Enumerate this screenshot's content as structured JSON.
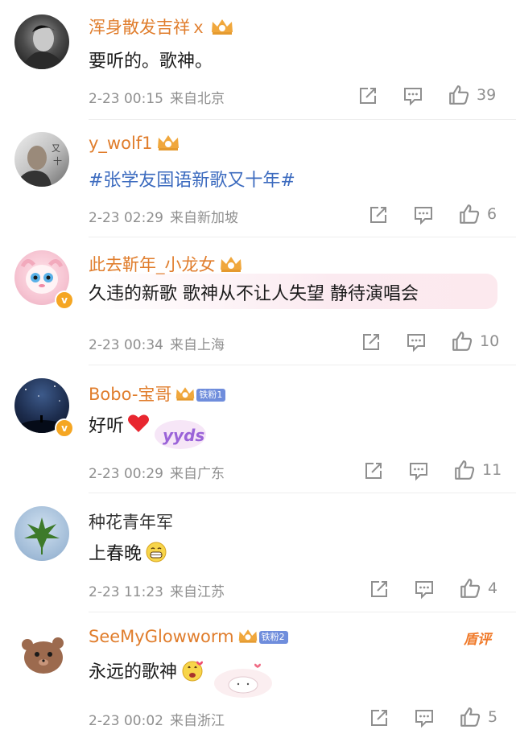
{
  "comments": [
    {
      "name": "浑身散发吉祥ｘ",
      "text": "要听的。歌神。",
      "date": "2-23 00:15",
      "location": "来自北京",
      "likes": "39"
    },
    {
      "name": "y_wolf1",
      "text": "#张学友国语新歌又十年#",
      "date": "2-23 02:29",
      "location": "来自新加坡",
      "likes": "6"
    },
    {
      "name": "此去靳年_小龙女",
      "text": "久违的新歌 歌神从不让人失望 静待演唱会",
      "date": "2-23 00:34",
      "location": "来自上海",
      "likes": "10"
    },
    {
      "name": "Bobo-宝哥",
      "fan_badge": "铁粉1",
      "text": "好听",
      "sticker": "yyds",
      "date": "2-23 00:29",
      "location": "来自广东",
      "likes": "11"
    },
    {
      "name": "种花青年军",
      "text": "上春晚",
      "date": "2-23 11:23",
      "location": "来自江苏",
      "likes": "4"
    },
    {
      "name": "SeeMyGlowworm",
      "fan_badge": "铁粉2",
      "hot_label": "盾评",
      "text": "永远的歌神",
      "date": "2-23 00:02",
      "location": "来自浙江",
      "likes": "5"
    }
  ],
  "icons": [
    "crown-icon",
    "share-icon",
    "comment-icon",
    "like-icon",
    "heart-emoji-icon",
    "grin-emoji-icon",
    "love-emoji-icon"
  ],
  "colors": {
    "username": "#e07d2c",
    "topic": "#3c6bbf",
    "meta": "#8f8f8f",
    "fan_badge": "#6f8ddc",
    "verified": "#f5a623"
  }
}
